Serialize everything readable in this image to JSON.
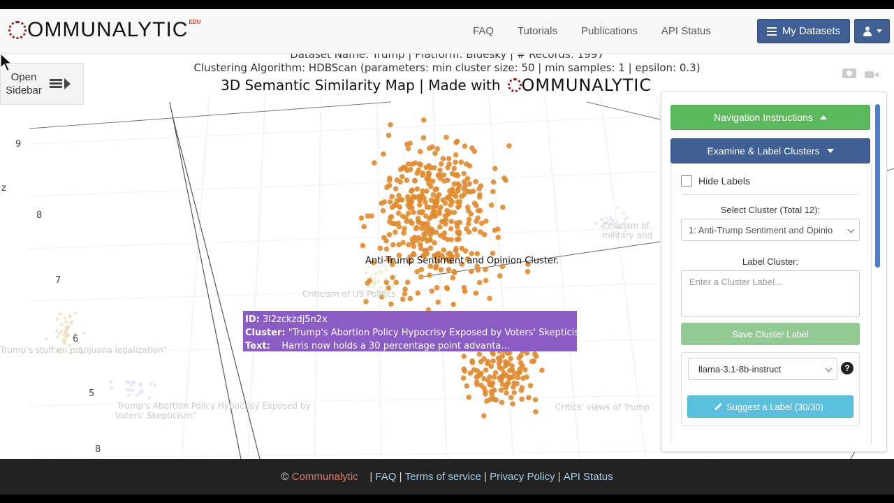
{
  "navbar": {
    "logo_text": "OMMUNALYTIC",
    "logo_edu": "EDU",
    "links": [
      "FAQ",
      "Tutorials",
      "Publications",
      "API Status"
    ],
    "my_datasets": "My Datasets"
  },
  "plot": {
    "dataset_line": "Dataset Name: Trump | Platform: Bluesky | # Records: 1997",
    "clustering_line": "Clustering Algorithm: HDBScan (parameters: min cluster size: 50 | min samples: 1 | epsilon: 0.3)",
    "title_prefix": "3D Semantic Similarity Map | Made with",
    "title_logo": "OMMUNALYTIC",
    "open_sidebar": "Open Sidebar",
    "axis_z_label": "z",
    "ticks": [
      "9",
      "8",
      "7",
      "6",
      "5",
      "8"
    ],
    "cluster_label": "Anti-Trump Sentiment and Opinion Cluster.",
    "faint_labels": [
      "Criticism of US Politics",
      "Trump's stuff on marijuana legalization\"",
      "Trump's Abortion Policy Hypocrisy Exposed by",
      "Voters' Skepticism\"",
      "Critics' views of Trump",
      "Criticism of",
      "military and"
    ],
    "point_color": "#e08a2e"
  },
  "tooltip": {
    "id_label": "ID:",
    "id_value": "3l2zckzdj5n2x",
    "cluster_label": "Cluster:",
    "cluster_value": "\"Trump's Abortion Policy Hypocrisy Exposed by Voters' Skepticism\".",
    "text_label": "Text:",
    "text_value": "Harris now holds a 30 percentage point advanta..."
  },
  "panel": {
    "nav_instructions": "Navigation Instructions",
    "examine_label": "Examine & Label Clusters",
    "hide_labels": "Hide Labels",
    "select_cluster_label": "Select Cluster (Total 12):",
    "selected_cluster": "1: Anti-Trump Sentiment and Opinio",
    "label_cluster": "Label Cluster:",
    "label_placeholder": "Enter a Cluster Label...",
    "save_button": "Save Cluster Label",
    "model": "llama-3.1-8b-instruct",
    "help": "?",
    "suggest_button": "Suggest a Label (30/30)"
  },
  "footer": {
    "copyright": "©",
    "brand": "Communalytic",
    "links": [
      "FAQ",
      "Terms of service",
      "Privacy Policy",
      "API Status"
    ]
  }
}
